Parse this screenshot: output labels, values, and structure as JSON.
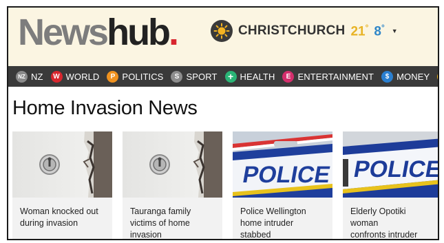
{
  "brand": {
    "name_part1": "News",
    "name_part2": "hub",
    "name_dot": "."
  },
  "weather": {
    "icon": "sun-icon",
    "city": "CHRISTCHURCH",
    "high": "21",
    "low": "8",
    "degree_symbol": "°",
    "caret": "▼"
  },
  "nav": {
    "items": [
      {
        "badge": "NZ",
        "label": "NZ",
        "color": "#8a8a8a"
      },
      {
        "badge": "W",
        "label": "WORLD",
        "color": "#d8262e"
      },
      {
        "badge": "P",
        "label": "POLITICS",
        "color": "#f0921f"
      },
      {
        "badge": "S",
        "label": "SPORT",
        "color": "#8d8d8d"
      },
      {
        "badge": "+",
        "label": "HEALTH",
        "color": "#2ab576"
      },
      {
        "badge": "E",
        "label": "ENTERTAINMENT",
        "color": "#d42e6c"
      },
      {
        "badge": "$",
        "label": "MONEY",
        "color": "#2a7fd0"
      }
    ],
    "overflow_color": "#f2b51d"
  },
  "page": {
    "title": "Home Invasion News"
  },
  "articles": [
    {
      "title_line1": "Woman knocked out",
      "title_line2": "during invasion",
      "title_line3": "",
      "image": "door-lock"
    },
    {
      "title_line1": "Tauranga family",
      "title_line2": "victims of home",
      "title_line3": "invasion",
      "image": "door-lock"
    },
    {
      "title_line1": "Police Wellington",
      "title_line2": "home intruder stabbed",
      "title_line3": "",
      "image": "police-car"
    },
    {
      "title_line1": "Elderly Opotiki woman",
      "title_line2": "confronts intruder",
      "title_line3": "",
      "image": "police-car"
    }
  ],
  "images": {
    "police_text": "POLICE"
  }
}
